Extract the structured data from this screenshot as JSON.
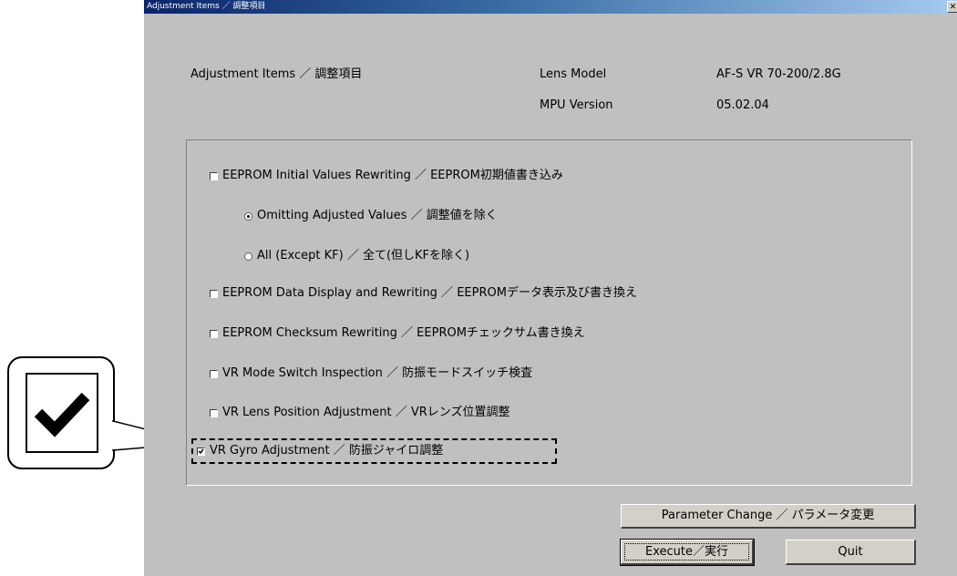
{
  "window": {
    "title": "Adjustment Items ／ 調整項目",
    "close_glyph": "✕"
  },
  "header": {
    "heading": "Adjustment Items  ／  調整項目",
    "lens_model_label": "Lens  Model",
    "lens_model_value": "AF-S VR 70-200/2.8G",
    "mpu_version_label": "MPU Version",
    "mpu_version_value": "05.02.04"
  },
  "options": {
    "eeprom_initial": {
      "label": "EEPROM Initial Values Rewriting  ／  EEPROM初期値書き込み",
      "checked": false
    },
    "omitting_adjusted": {
      "label": "Omitting Adjusted Values  ／  調整値を除く",
      "selected": true
    },
    "all_except_kf": {
      "label": "All (Except KF)  ／  全て(但しKFを除く)",
      "selected": false
    },
    "eeprom_display": {
      "label": "EEPROM Data Display and Rewriting  ／  EEPROMデータ表示及び書き換え",
      "checked": false
    },
    "eeprom_checksum": {
      "label": "EEPROM Checksum Rewriting  ／  EEPROMチェックサム書き換え",
      "checked": false
    },
    "vr_mode_switch": {
      "label": "VR Mode Switch Inspection  ／  防振モードスイッチ検査",
      "checked": false
    },
    "vr_lens_position": {
      "label": "VR Lens Position Adjustment  ／  VRレンズ位置調整",
      "checked": false
    },
    "vr_gyro": {
      "label": "VR Gyro Adjustment  ／  防振ジャイロ調整",
      "checked": true
    }
  },
  "buttons": {
    "parameter_change": "Parameter Change  ／  パラメータ変更",
    "execute": "Execute／実行",
    "quit": "Quit"
  },
  "callout": {
    "icon": "checkmark-icon"
  }
}
